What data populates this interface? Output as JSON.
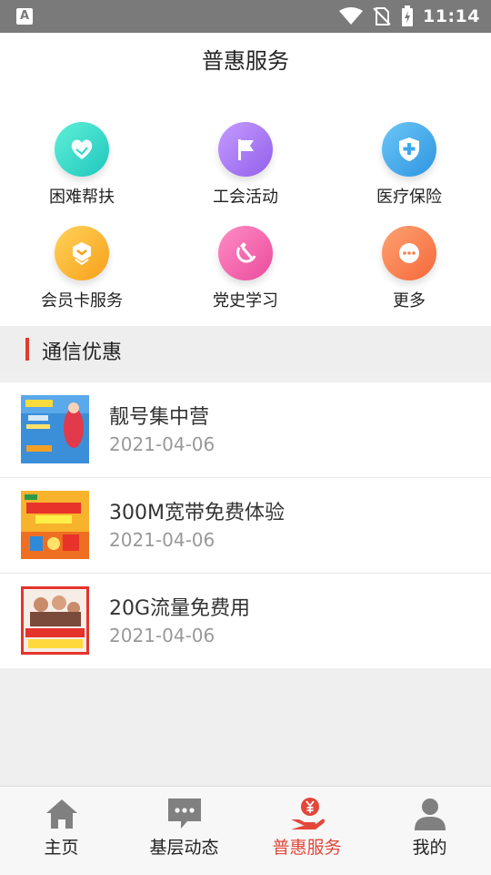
{
  "status_bar": {
    "time": "11:14",
    "app_icon_letter": "A"
  },
  "header": {
    "title": "普惠服务"
  },
  "grid": [
    {
      "label": "困难帮扶",
      "icon": "heart-hand-icon",
      "color": "#2fd6c6"
    },
    {
      "label": "工会活动",
      "icon": "flag-icon",
      "color": "#a777f2"
    },
    {
      "label": "医疗保险",
      "icon": "medical-shield-icon",
      "color": "#3ea8ea"
    },
    {
      "label": "会员卡服务",
      "icon": "badge-icon",
      "color": "#fbb12e"
    },
    {
      "label": "党史学习",
      "icon": "hammer-sickle-icon",
      "color": "#f261ad"
    },
    {
      "label": "更多",
      "icon": "more-icon",
      "color": "#fb7b4c"
    }
  ],
  "section": {
    "title": "通信优惠"
  },
  "list": [
    {
      "title": "靓号集中营",
      "date": "2021-04-06"
    },
    {
      "title": "300M宽带免费体验",
      "date": "2021-04-06"
    },
    {
      "title": "20G流量免费用",
      "date": "2021-04-06"
    }
  ],
  "nav": [
    {
      "label": "主页",
      "icon": "home-icon"
    },
    {
      "label": "基层动态",
      "icon": "chat-icon"
    },
    {
      "label": "普惠服务",
      "icon": "yuan-hand-icon",
      "active": true
    },
    {
      "label": "我的",
      "icon": "person-icon"
    }
  ],
  "colors": {
    "accent": "#e3473a",
    "section_bar": "#e23a2f"
  }
}
